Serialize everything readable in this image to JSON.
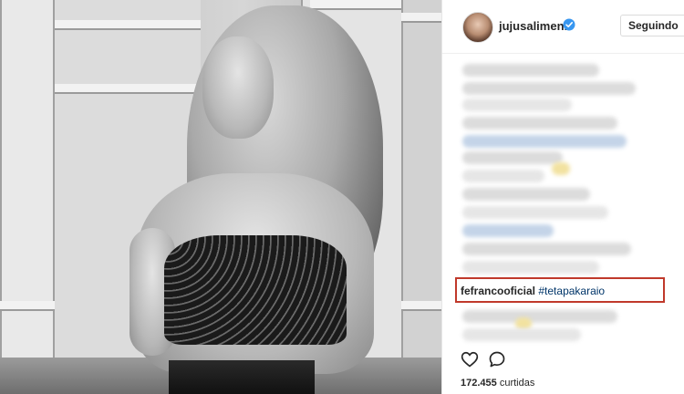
{
  "post": {
    "username": "jujusalimeni",
    "follow_button": "Seguindo",
    "highlighted_comment": {
      "user": "fefrancooficial",
      "hashtag": "#tetapakaraio"
    },
    "likes_count": "172.455",
    "likes_label": "curtidas"
  },
  "icons": {
    "verified": "verified-badge-icon",
    "like": "heart-icon",
    "comment": "comment-bubble-icon"
  },
  "colors": {
    "verified_blue": "#3897f0",
    "highlight_border": "#c0392b",
    "hashtag": "#003569"
  }
}
